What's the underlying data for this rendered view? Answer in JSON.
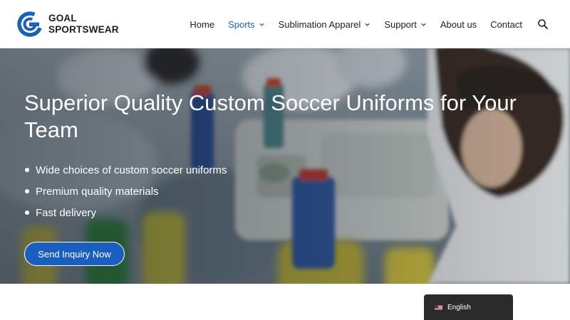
{
  "brand": {
    "line1": "GOAL",
    "line2": "SPORTSWEAR",
    "logo_icon": "g-logo-icon",
    "accent": "#1a62b5"
  },
  "nav": {
    "items": [
      {
        "label": "Home",
        "active": false,
        "dropdown": false
      },
      {
        "label": "Sports",
        "active": true,
        "dropdown": true
      },
      {
        "label": "Sublimation Apparel",
        "active": false,
        "dropdown": true
      },
      {
        "label": "Support",
        "active": false,
        "dropdown": true
      },
      {
        "label": "About us",
        "active": false,
        "dropdown": false
      },
      {
        "label": "Contact",
        "active": false,
        "dropdown": false
      }
    ],
    "search_icon": "search-icon"
  },
  "hero": {
    "title": "Superior Quality Custom Soccer Uniforms for Your Team",
    "bullets": [
      "Wide choices of custom soccer uniforms",
      "Premium quality materials",
      "Fast delivery"
    ],
    "cta_label": "Send Inquiry Now",
    "cta_color": "#1a5fc0"
  },
  "language": {
    "label": "English",
    "flag_icon": "us-flag-icon"
  }
}
